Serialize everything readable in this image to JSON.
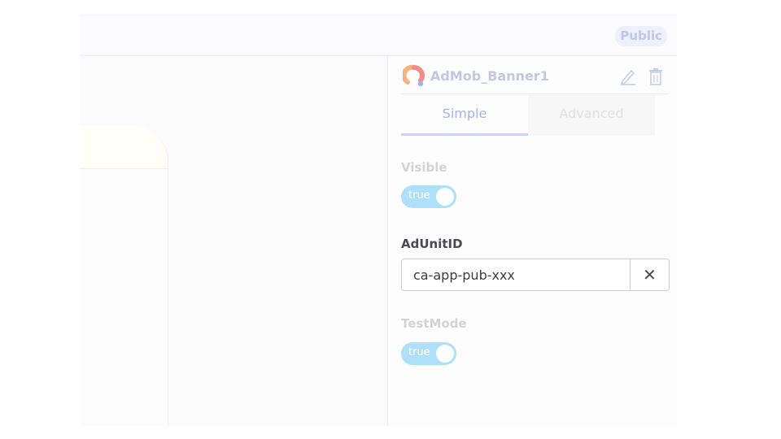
{
  "header": {
    "visibility_badge": "Public"
  },
  "component": {
    "name": "AdMob_Banner1",
    "icon": "admob-logo-icon"
  },
  "tabs": [
    {
      "label": "Simple",
      "active": true
    },
    {
      "label": "Advanced",
      "active": false
    }
  ],
  "properties": {
    "visible": {
      "label": "Visible",
      "value": "true"
    },
    "ad_unit_id": {
      "label": "AdUnitID",
      "value": "ca-app-pub-xxx",
      "clear_icon": "close-icon",
      "clear_glyph": "✕"
    },
    "test_mode": {
      "label": "TestMode",
      "value": "true"
    }
  },
  "colors": {
    "accent": "#aab2e6",
    "toggle_on": "#aee0f9"
  }
}
